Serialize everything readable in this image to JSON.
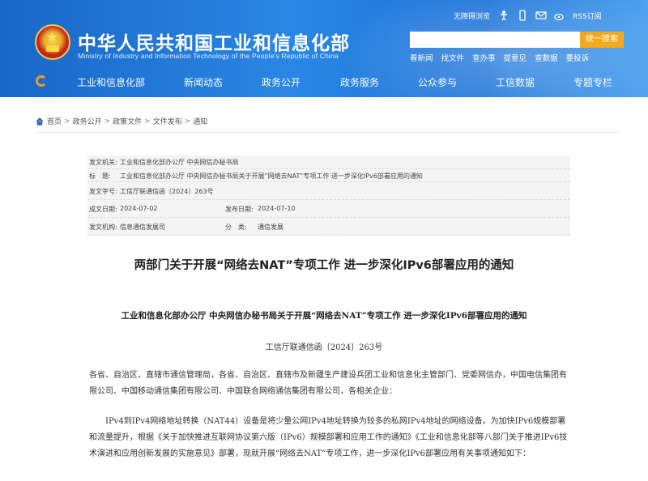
{
  "header": {
    "title": "中华人民共和国工业和信息化部",
    "subtitle": "Ministry of Industry and Information Technology of the People's Republic of China",
    "toplinks": {
      "accessible": "无障碍浏览",
      "rss": "RSS订阅"
    },
    "icons": [
      "accessibility-icon",
      "mobile-icon",
      "mail-icon",
      "weibo-icon",
      "rss-icon"
    ],
    "search": {
      "placeholder": "",
      "button": "统一搜索"
    },
    "quick_links": [
      "看新闻",
      "找文件",
      "查办事",
      "提意见",
      "查数据",
      "要投诉"
    ]
  },
  "nav": {
    "items": [
      "工业和信息化部",
      "新闻动态",
      "政务公开",
      "政务服务",
      "公众参与",
      "工信数据",
      "专题专栏"
    ]
  },
  "breadcrumb": [
    "首页",
    "政务公开",
    "政策文件",
    "文件发布",
    "通知"
  ],
  "meta": {
    "issuer_label": "发文机关:",
    "issuer": "工业和信息化部办公厅 中央网信办秘书局",
    "title_label": "标　题:",
    "title": "工业和信息化部办公厅 中央网信办秘书局关于开展“网络去NAT”专项工作 进一步深化IPv6部署应用的通知",
    "docno_label": "发文字号:",
    "docno": "工信厅联通信函〔2024〕263号",
    "date_label": "成文日期:",
    "date": "2024-07-02",
    "pubdate_label": "发布日期:",
    "pubdate": "2024-07-10",
    "org_label": "发文机构:",
    "org": "信息通信发展司",
    "category_label": "分　类:",
    "category": "通信发展"
  },
  "article": {
    "title": "两部门关于开展“网络去NAT”专项工作 进一步深化IPv6部署应用的通知",
    "subtitle": "工业和信息化部办公厅 中央网信办秘书局关于开展“网络去NAT”专项工作 进一步深化IPv6部署应用的通知",
    "doc_number": "工信厅联通信函〔2024〕263号",
    "para1": "各省、自治区、直辖市通信管理局，各省、自治区、直辖市及新疆生产建设兵团工业和信息化主管部门、党委网信办，中国电信集团有限公司、中国移动通信集团有限公司、中国联合网络通信集团有限公司，各相关企业：",
    "para2": "IPv4到IPv4网络地址转换（NAT44）设备是将少量公网IPv4地址转换为较多的私网IPv4地址的网络设备。为加快IPv6规模部署和流量提升，根据《关于加快推进互联网协议第六版（IPv6）规模部署和应用工作的通知》《工业和信息化部等八部门关于推进IPv6技术演进和应用创新发展的实施意见》部署，现就开展“网络去NAT”专项工作，进一步深化IPv6部署应用有关事项通知如下："
  }
}
